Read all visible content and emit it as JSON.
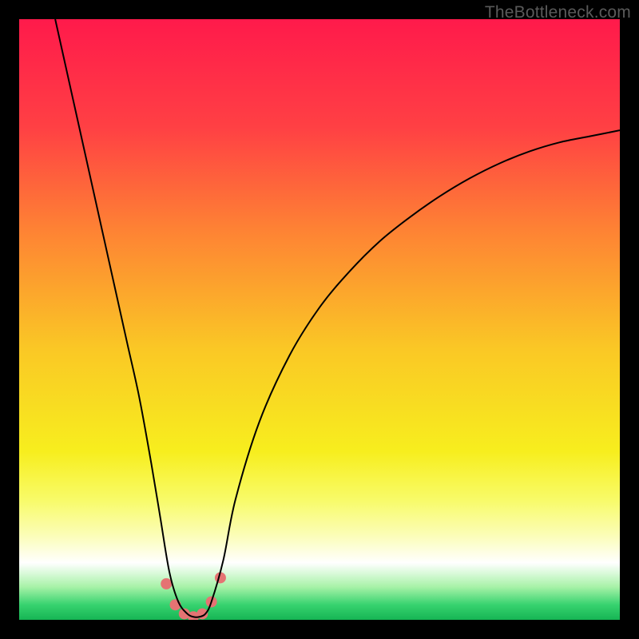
{
  "watermark": "TheBottleneck.com",
  "chart_data": {
    "type": "line",
    "title": "",
    "xlabel": "",
    "ylabel": "",
    "xlim": [
      0,
      100
    ],
    "ylim": [
      0,
      100
    ],
    "grid": false,
    "legend": false,
    "background_gradient": {
      "stops": [
        {
          "offset": 0.0,
          "color": "#ff1a4b"
        },
        {
          "offset": 0.18,
          "color": "#ff4044"
        },
        {
          "offset": 0.35,
          "color": "#fe8234"
        },
        {
          "offset": 0.55,
          "color": "#fac825"
        },
        {
          "offset": 0.72,
          "color": "#f7ee1e"
        },
        {
          "offset": 0.8,
          "color": "#f8fb68"
        },
        {
          "offset": 0.86,
          "color": "#fbfdb8"
        },
        {
          "offset": 0.905,
          "color": "#ffffff"
        },
        {
          "offset": 0.945,
          "color": "#a8f2a8"
        },
        {
          "offset": 0.975,
          "color": "#37d36f"
        },
        {
          "offset": 1.0,
          "color": "#16b554"
        }
      ]
    },
    "series": [
      {
        "name": "bottleneck-curve",
        "color": "#000000",
        "stroke_width": 2,
        "x": [
          6,
          8,
          10,
          12,
          14,
          16,
          18,
          20,
          22,
          23.5,
          25,
          26.5,
          28,
          29,
          30,
          31,
          32,
          34,
          36,
          40,
          45,
          50,
          55,
          60,
          65,
          70,
          75,
          80,
          85,
          90,
          95,
          100
        ],
        "y": [
          100,
          91,
          82,
          73,
          64,
          55,
          46,
          37,
          26,
          17,
          8,
          3,
          1,
          0.5,
          0.5,
          1,
          3,
          10,
          20,
          33,
          44,
          52,
          58,
          63,
          67,
          70.5,
          73.5,
          76,
          78,
          79.5,
          80.5,
          81.5
        ]
      }
    ],
    "markers": {
      "name": "trough-markers",
      "color": "#e57373",
      "radius": 7,
      "points": [
        {
          "x": 24.5,
          "y": 6
        },
        {
          "x": 26,
          "y": 2.5
        },
        {
          "x": 27.5,
          "y": 1
        },
        {
          "x": 29,
          "y": 0.5
        },
        {
          "x": 30.5,
          "y": 1
        },
        {
          "x": 32,
          "y": 3
        },
        {
          "x": 33.5,
          "y": 7
        }
      ]
    }
  }
}
